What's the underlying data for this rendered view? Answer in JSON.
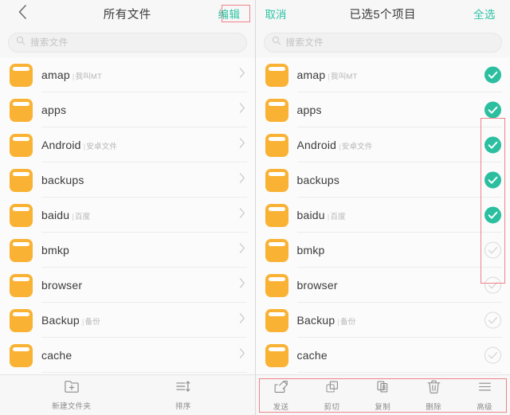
{
  "left": {
    "nav": {
      "back_icon": "chevron-left-icon",
      "title": "所有文件",
      "action_label": "编辑"
    },
    "search": {
      "icon": "search-icon",
      "placeholder": "搜索文件"
    },
    "toolbar": [
      {
        "icon": "new-folder-icon",
        "label": "新建文件夹"
      },
      {
        "icon": "sort-icon",
        "label": "排序"
      }
    ]
  },
  "right": {
    "nav": {
      "cancel_label": "取消",
      "title": "已选5个项目",
      "select_all_label": "全选"
    },
    "search": {
      "icon": "search-icon",
      "placeholder": "搜索文件"
    },
    "toolbar": [
      {
        "icon": "share-icon",
        "label": "发送"
      },
      {
        "icon": "cut-icon",
        "label": "剪切"
      },
      {
        "icon": "copy-icon",
        "label": "复制"
      },
      {
        "icon": "trash-icon",
        "label": "删除"
      },
      {
        "icon": "menu-icon",
        "label": "高级"
      }
    ]
  },
  "files": [
    {
      "name": "amap",
      "alias": "我叫MT",
      "selected": true
    },
    {
      "name": "apps",
      "alias": "",
      "selected": true
    },
    {
      "name": "Android",
      "alias": "安卓文件",
      "selected": true
    },
    {
      "name": "backups",
      "alias": "",
      "selected": true
    },
    {
      "name": "baidu",
      "alias": "百度",
      "selected": true
    },
    {
      "name": "bmkp",
      "alias": "",
      "selected": false
    },
    {
      "name": "browser",
      "alias": "",
      "selected": false
    },
    {
      "name": "Backup",
      "alias": "备份",
      "selected": false
    },
    {
      "name": "cache",
      "alias": "",
      "selected": false
    }
  ],
  "colors": {
    "accent": "#2ec4a6",
    "check_on": "#2bbfa0",
    "folder": "#f9b233",
    "annotation": "#ef8289",
    "background": "#f7f7f7",
    "list_background": "#fbfbfb"
  },
  "separator": "|"
}
